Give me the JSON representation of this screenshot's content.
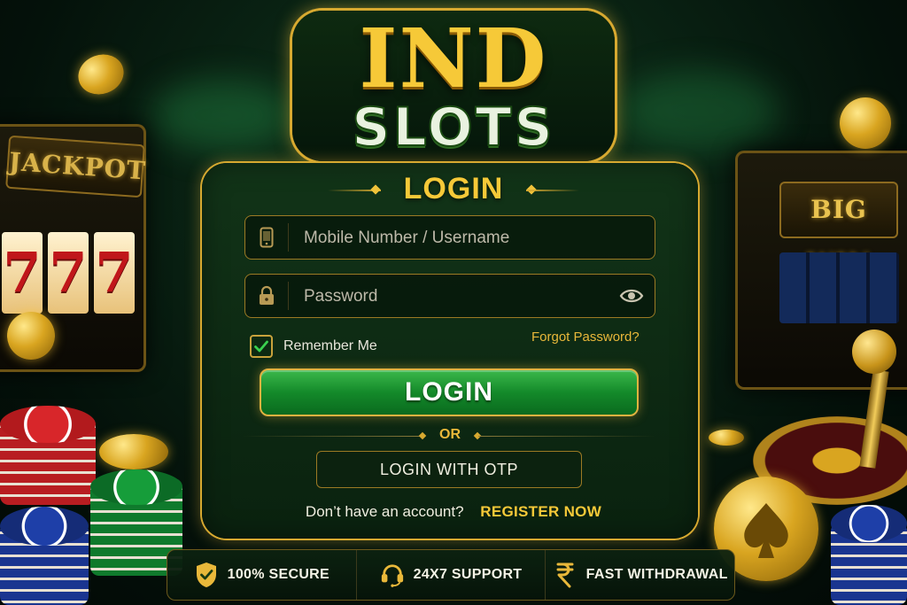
{
  "logo": {
    "line1": "IND",
    "line2": "SLOTS"
  },
  "background": {
    "left_sign": "JACKPOT",
    "right_sign": "BIG WIN",
    "reel_symbol": "7"
  },
  "login_card": {
    "title": "LOGIN",
    "username_field": {
      "placeholder": "Mobile Number / Username",
      "value": "",
      "icon": "phone-icon"
    },
    "password_field": {
      "placeholder": "Password",
      "value": "",
      "icon": "lock-icon",
      "toggle_icon": "eye-icon"
    },
    "remember_me": {
      "label": "Remember Me",
      "checked": true
    },
    "forgot_password": "Forgot Password?",
    "login_button": "LOGIN",
    "divider_text": "OR",
    "otp_button": "LOGIN WITH OTP",
    "signup_prompt": "Don’t have an account?",
    "register_link": "REGISTER NOW"
  },
  "features": [
    {
      "label": "100% SECURE",
      "icon": "shield-check-icon"
    },
    {
      "label": "24X7 SUPPORT",
      "icon": "headset-icon"
    },
    {
      "label": "FAST WITHDRAWAL",
      "icon": "rupee-icon"
    }
  ],
  "colors": {
    "gold": "#f6c938",
    "gold_border": "#d7a930",
    "green_button": "#148a2a",
    "card_bg": "#12341a",
    "check_green": "#3ad04f"
  }
}
